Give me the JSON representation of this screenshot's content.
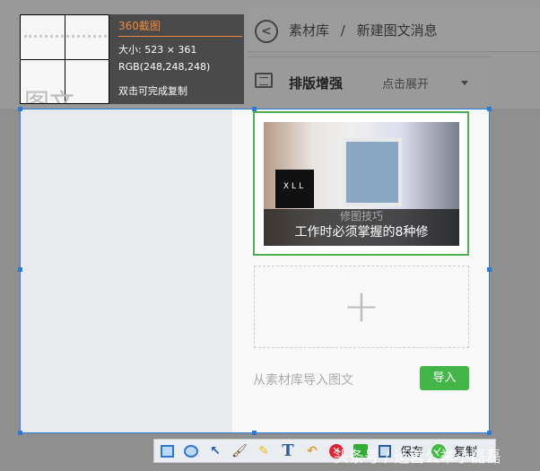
{
  "header": {
    "back_icon": "back-arrow-icon",
    "breadcrumb": [
      "素材库",
      "/",
      "新建图文消息"
    ]
  },
  "toolbar2": {
    "title": "排版增强",
    "expand": "点击展开"
  },
  "article": {
    "logo": "XLL",
    "category": "修图技巧",
    "title": "工作时必须掌握的8种修"
  },
  "import": {
    "label": "从素材库导入图文",
    "button": "导入"
  },
  "magnifier": {
    "app": "360截图",
    "size": "大小: 523 × 361",
    "rgb": "RGB(248,248,248)",
    "hint": "双击可完成复制",
    "preview_text": "图文"
  },
  "screenshot_toolbar": {
    "save": "保存",
    "copy": "复制"
  },
  "watermark": "头条号 / 运营公举小磊磊",
  "colors": {
    "accent": "#44b549",
    "selection": "#2b7bd6",
    "brand": "#f08a3c"
  }
}
